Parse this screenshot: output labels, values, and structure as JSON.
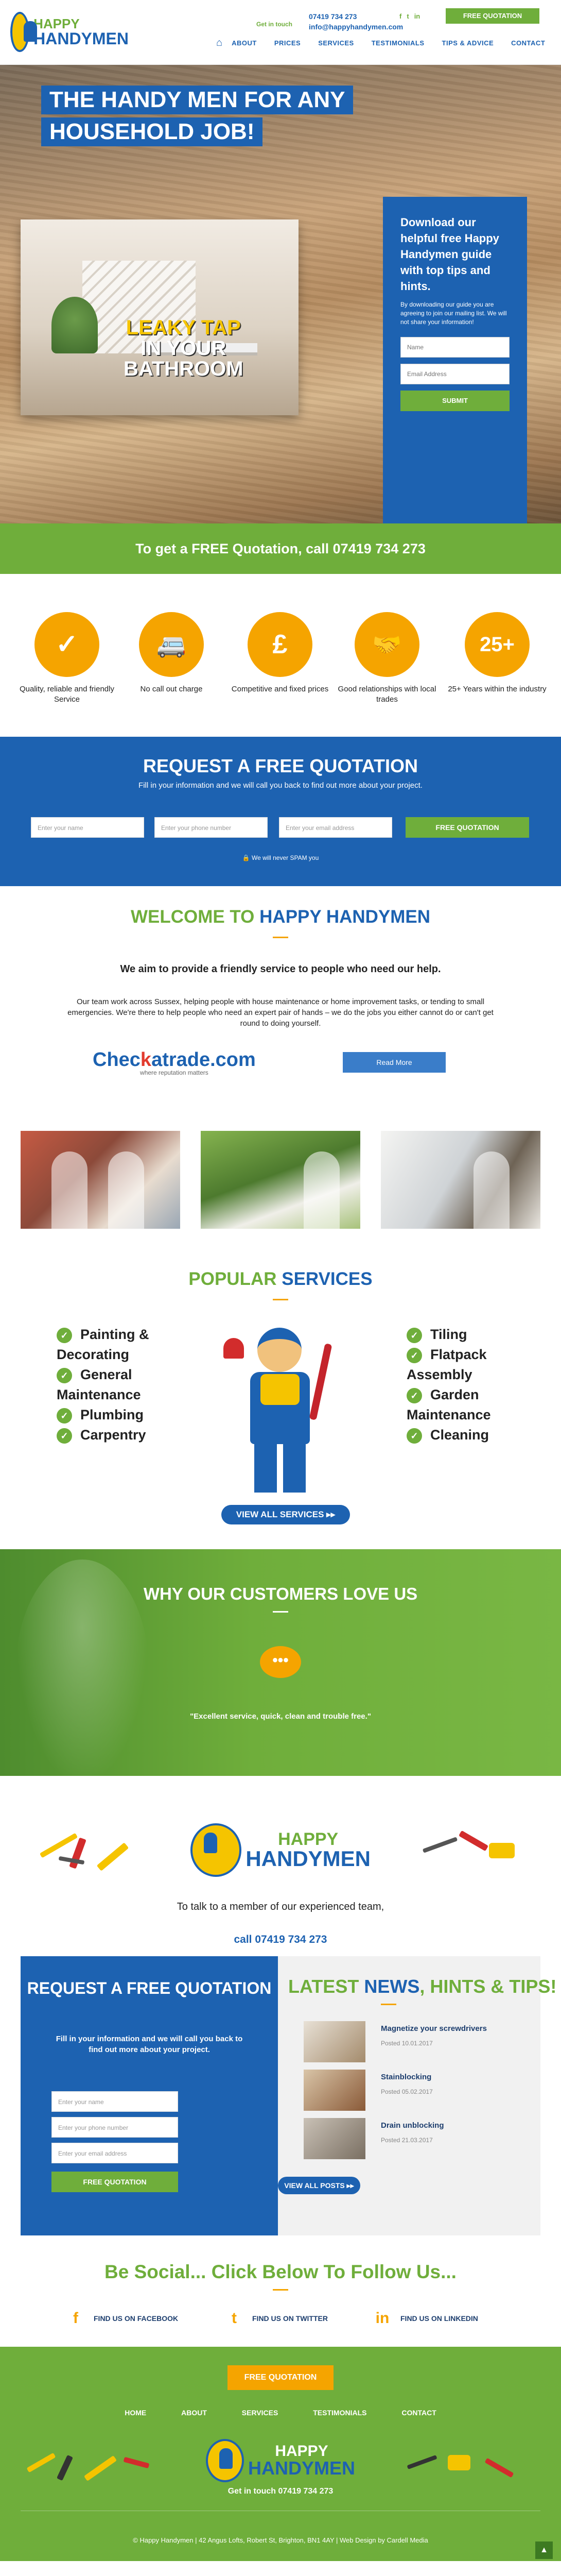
{
  "header": {
    "brand_line1": "HAPPY",
    "brand_line2": "HANDYMEN",
    "get_in_touch": "Get in touch",
    "phone": "07419 734 273",
    "email": "info@happyhandymen.com",
    "social": [
      "f",
      "t",
      "in"
    ],
    "quote_button": "FREE QUOTATION",
    "nav": [
      "ABOUT",
      "PRICES",
      "SERVICES",
      "TESTIMONIALS",
      "TIPS & ADVICE",
      "CONTACT"
    ]
  },
  "hero": {
    "title_lines": [
      "THE HANDY MEN FOR ANY",
      "HOUSEHOLD JOB!"
    ],
    "photo_caption_1": "LEAKY TAP",
    "photo_caption_2": "IN YOUR",
    "photo_caption_3": "BATHROOM",
    "guide_title": "Download our helpful free Happy Handymen guide with top tips and hints.",
    "guide_sub": "By downloading our guide you are agreeing to join our mailing list. We will not share your information!",
    "name_placeholder": "Name",
    "email_placeholder": "Email Address",
    "submit": "SUBMIT"
  },
  "quote_bar": "To get a FREE Quotation, call 07419 734 273",
  "features": [
    {
      "icon": "check-icon",
      "glyph": "✓",
      "text": "Quality, reliable and friendly Service"
    },
    {
      "icon": "van-icon",
      "glyph": "🚐",
      "text": "No call out charge"
    },
    {
      "icon": "pound-icon",
      "glyph": "£",
      "text": "Competitive and fixed prices"
    },
    {
      "icon": "handshake-icon",
      "glyph": "🤝",
      "text": "Good relationships with local trades"
    },
    {
      "icon": "years-badge-icon",
      "glyph": "25+",
      "text": "25+ Years within the industry"
    }
  ],
  "request": {
    "title": "REQUEST A FREE QUOTATION",
    "subtitle": "Fill in your information and we will call you back to find out more about your project.",
    "name_ph": "Enter your name",
    "phone_ph": "Enter your phone number",
    "email_ph": "Enter your email address",
    "button": "FREE QUOTATION",
    "spam": "We will never SPAM you"
  },
  "welcome": {
    "title_1": "WELCOME TO ",
    "title_2": "HAPPY HANDYMEN",
    "lead": "We aim to provide a friendly service to people who need our help.",
    "body": "Our team work across Sussex, helping people with house maintenance or home improvement tasks, or tending to small emergencies. We're there to help people who need an expert pair of hands – we do the jobs you either cannot do or can't get round to doing yourself.",
    "checka_1": "Chec",
    "checka_2": "k",
    "checka_3": "atrade.com",
    "checka_tag": "where reputation matters",
    "read_more": "Read More"
  },
  "services": {
    "title_1": "POPULAR ",
    "title_2": "SERVICES",
    "left": [
      "Painting &",
      "Decorating",
      "General",
      "Maintenance",
      "Plumbing",
      "Carpentry"
    ],
    "left_ticks": [
      true,
      false,
      true,
      false,
      true,
      true
    ],
    "right": [
      "Tiling",
      "Flatpack",
      "Assembly",
      "Garden",
      "Maintenance",
      "Cleaning"
    ],
    "right_ticks": [
      true,
      true,
      false,
      true,
      false,
      true
    ],
    "view_all": "VIEW ALL SERVICES ▸▸"
  },
  "testimonial": {
    "title": "WHY OUR CUSTOMERS LOVE US",
    "bubble": "•••",
    "quote": "\"Excellent service, quick, clean and trouble free.\""
  },
  "brand": {
    "brand_line1": "HAPPY",
    "brand_line2": "HANDYMEN",
    "text": "To talk to a member of our experienced team,",
    "phone": "call 07419 734 273"
  },
  "quote_box": {
    "title": "REQUEST A FREE QUOTATION",
    "subtitle": "Fill in your information and we will call you back to find out more about your project.",
    "name_ph": "Enter your name",
    "phone_ph": "Enter your phone number",
    "email_ph": "Enter your email address",
    "button": "FREE QUOTATION"
  },
  "news": {
    "title_1": "LATEST ",
    "title_2": "NEWS",
    "title_3": ", HINTS & TIPS!",
    "items": [
      {
        "title": "Magnetize your screwdrivers",
        "date": "Posted 10.01.2017"
      },
      {
        "title": "Stainblocking",
        "date": "Posted 05.02.2017"
      },
      {
        "title": "Drain unblocking",
        "date": "Posted 21.03.2017"
      }
    ],
    "button": "VIEW ALL POSTS ▸▸"
  },
  "social": {
    "title": "Be Social... Click Below To Follow Us...",
    "links": [
      {
        "icon": "facebook-icon",
        "glyph": "f",
        "label": "FIND US ON FACEBOOK"
      },
      {
        "icon": "twitter-icon",
        "glyph": "t",
        "label": "FIND US ON TWITTER"
      },
      {
        "icon": "linkedin-icon",
        "glyph": "in",
        "label": "FIND US ON LINKEDIN"
      }
    ]
  },
  "footer": {
    "button": "FREE QUOTATION",
    "nav": [
      "HOME",
      "ABOUT",
      "SERVICES",
      "TESTIMONIALS",
      "CONTACT"
    ],
    "brand_line1": "HAPPY",
    "brand_line2": "HANDYMEN",
    "touch": "Get in touch 07419 734 273",
    "copyright": "© Happy Handymen  |  42 Angus Lofts, Robert St, Brighton, BN1 4AY  |  Web Design by Cardell Media",
    "to_top": "▲"
  },
  "colors": {
    "green": "#6fae3b",
    "blue": "#1d62b1",
    "orange": "#f5a400",
    "yellow": "#f5c400"
  }
}
